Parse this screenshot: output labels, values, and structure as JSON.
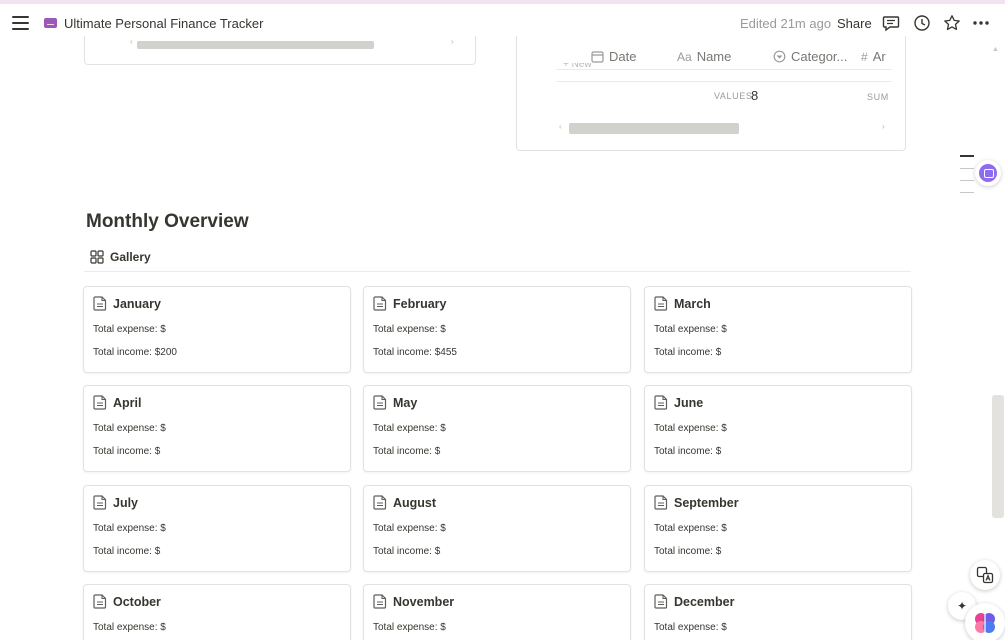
{
  "header": {
    "page_title": "Ultimate Personal Finance Tracker",
    "edited": "Edited 21m ago",
    "share_label": "Share"
  },
  "database_view": {
    "columns": [
      {
        "icon": "calendar-icon",
        "label": "Date"
      },
      {
        "icon": "text-icon",
        "label": "Name",
        "prefix": "Aa"
      },
      {
        "icon": "select-icon",
        "label": "Categor..."
      },
      {
        "icon": "number-icon",
        "label": "Ar",
        "prefix": "#"
      }
    ],
    "new_label": "+ New",
    "values_label": "VALUES",
    "values_count": "8",
    "sum_label": "SUM"
  },
  "monthly_overview": {
    "title": "Monthly Overview",
    "view_label": "Gallery",
    "cards": [
      {
        "title": "January",
        "expense": "Total expense: $",
        "income": "Total income: $200"
      },
      {
        "title": "February",
        "expense": "Total expense: $",
        "income": "Total income: $455"
      },
      {
        "title": "March",
        "expense": "Total expense: $",
        "income": "Total income: $"
      },
      {
        "title": "April",
        "expense": "Total expense: $",
        "income": "Total income: $"
      },
      {
        "title": "May",
        "expense": "Total expense: $",
        "income": "Total income: $"
      },
      {
        "title": "June",
        "expense": "Total expense: $",
        "income": "Total income: $"
      },
      {
        "title": "July",
        "expense": "Total expense: $",
        "income": "Total income: $"
      },
      {
        "title": "August",
        "expense": "Total expense: $",
        "income": "Total income: $"
      },
      {
        "title": "September",
        "expense": "Total expense: $",
        "income": "Total income: $"
      },
      {
        "title": "October",
        "expense": "Total expense: $",
        "income": "Total income: $"
      },
      {
        "title": "November",
        "expense": "Total expense: $",
        "income": "Total income: $"
      },
      {
        "title": "December",
        "expense": "Total expense: $",
        "income": "Total income: $"
      }
    ]
  },
  "colors": {
    "text": "#37352f",
    "muted": "#9b9a97",
    "border": "#e3e2df",
    "page_icon": "#9b59b6",
    "assistant": "#8e6cf0"
  }
}
